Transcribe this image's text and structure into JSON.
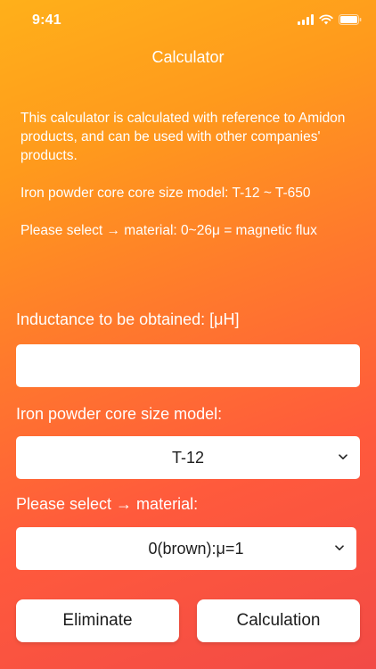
{
  "status_bar": {
    "time": "9:41",
    "icons": [
      "signal-icon",
      "wifi-icon",
      "battery-icon"
    ]
  },
  "nav": {
    "title": "Calculator"
  },
  "intro": {
    "paragraph_1": "This calculator is calculated with reference to Amidon products, and can be used with other companies' products.",
    "paragraph_2": "Iron powder core core size model: T-12 ~ T-650",
    "paragraph_3": "Please select → material: 0~26μ = magnetic flux"
  },
  "form": {
    "inductance_label": "Inductance to be obtained: [μH]",
    "inductance_value": "",
    "core_label": "Iron powder core size model:",
    "core_selected": "T-12",
    "material_label": "Please select → material:",
    "material_selected": "0(brown):μ=1"
  },
  "buttons": {
    "eliminate": "Eliminate",
    "calculation": "Calculation"
  },
  "colors": {
    "gradient_top": "#ffb01a",
    "gradient_mid": "#ff7a2c",
    "gradient_bottom": "#f24a46",
    "control_bg": "#ffffff",
    "text_light": "#ffffff",
    "text_dark": "#1c1c1c"
  }
}
